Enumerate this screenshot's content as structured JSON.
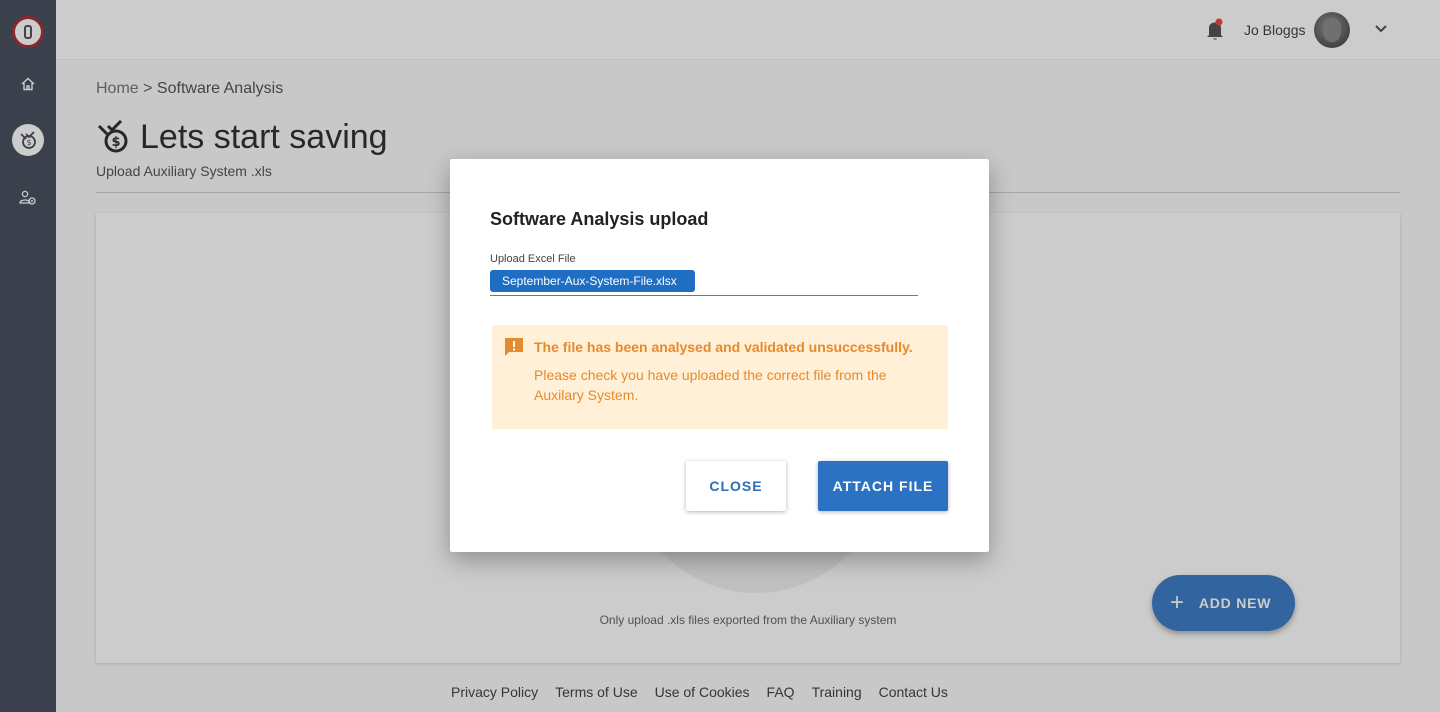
{
  "header": {
    "username": "Jo Bloggs"
  },
  "breadcrumb": {
    "home": "Home",
    "separator": " > ",
    "current": "Software Analysis"
  },
  "page": {
    "title": "Lets start saving",
    "subtitle": "Upload Auxiliary System .xls",
    "hint": "Only upload .xls files exported from the Auxiliary system",
    "fab_label": "ADD NEW"
  },
  "footer": {
    "links": [
      "Privacy Policy",
      "Terms of Use",
      "Use of Cookies",
      "FAQ",
      "Training",
      "Contact Us"
    ]
  },
  "modal": {
    "title": "Software Analysis upload",
    "field_label": "Upload Excel File",
    "file_name": "September-Aux-System-File.xlsx",
    "alert_title": "The file has been analysed and validated unsuccessfully.",
    "alert_body": "Please check you have uploaded the correct file from the Auxilary System.",
    "close_label": "CLOSE",
    "attach_label": "ATTACH FILE"
  },
  "colors": {
    "sidebar": "#4a5260",
    "primary": "#2b72c2",
    "warning_text": "#e68a2e",
    "warning_bg": "#fff0d7"
  },
  "icons": [
    "app-logo-icon",
    "home-icon",
    "savings-icon",
    "user-settings-icon",
    "bell-icon",
    "chevron-down-icon",
    "warning-icon",
    "plus-icon"
  ]
}
